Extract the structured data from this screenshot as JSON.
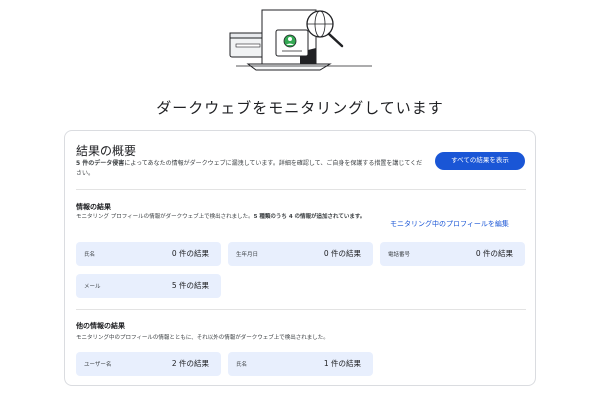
{
  "page": {
    "title": "ダークウェブをモニタリングしています"
  },
  "summary": {
    "title": "結果の概要",
    "description_bold": "5 件のデータ侵害",
    "description_rest": "によってあなたの情報がダークウェブに漏洩しています。詳細を確認して、ご自身を保護する措置を講じてください。",
    "view_all_label": "すべての結果を表示"
  },
  "info_results": {
    "title": "情報の結果",
    "desc_before": "モニタリング プロフィールの情報がダークウェブ上で検出されました。",
    "desc_bold": "5 種類のうち 4 の情報が追加されています。",
    "edit_link": "モニタリング中のプロフィールを編集",
    "tiles": [
      {
        "label": "氏名",
        "value": "0 件の結果"
      },
      {
        "label": "生年月日",
        "value": "0 件の結果"
      },
      {
        "label": "電話番号",
        "value": "0 件の結果"
      },
      {
        "label": "メール",
        "value": "5 件の結果"
      }
    ]
  },
  "other_results": {
    "title": "他の情報の結果",
    "desc": "モニタリング中のプロフィールの情報とともに、それ以外の情報がダークウェブ上で検出されました。",
    "tiles": [
      {
        "label": "ユーザー名",
        "value": "2 件の結果"
      },
      {
        "label": "氏名",
        "value": "1 件の結果"
      }
    ]
  },
  "colors": {
    "accent": "#1a56d6",
    "tile_bg": "#e8effd",
    "avatar": "#34a853"
  }
}
